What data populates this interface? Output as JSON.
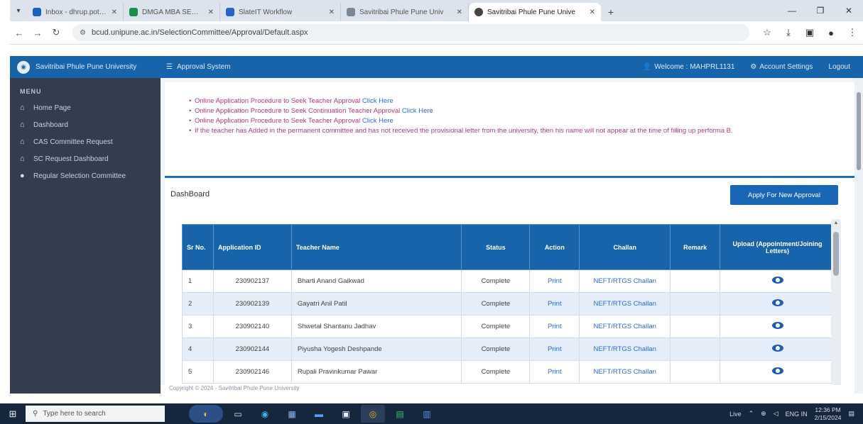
{
  "browser": {
    "tabs": [
      {
        "title": "Inbox - dhrup.pote@aeec",
        "active": false
      },
      {
        "title": "DMGA MBA SEU STATEME",
        "active": false
      },
      {
        "title": "SlateIT Workflow",
        "active": false
      },
      {
        "title": "Savitribai Phule Pune Univ",
        "active": false
      },
      {
        "title": "Savitribai Phule Pune Unive",
        "active": true
      }
    ],
    "url": "bcud.unipune.ac.in/SelectionCommittee/Approval/Default.aspx"
  },
  "header": {
    "university": "Savitribai Phule Pune University",
    "system": "Approval System",
    "welcome": "Welcome : MAHPRL1131",
    "account_settings": "Account Settings",
    "logout": "Logout"
  },
  "sidebar": {
    "menu_heading": "MENU",
    "items": [
      {
        "label": "Home Page"
      },
      {
        "label": "Dashboard"
      },
      {
        "label": "CAS Committee Request"
      },
      {
        "label": "SC Request Dashboard"
      },
      {
        "label": "Regular Selection Committee"
      }
    ]
  },
  "notices": [
    {
      "text": "Online Application Procedure to Seek Teacher Approval",
      "link": "Click Here"
    },
    {
      "text": "Online Application Procedure to Seek Continuation Teacher Approval",
      "link": "Click Here"
    },
    {
      "text": "Online Application Procedure to Seek Teacher Approval",
      "link": "Click Here"
    },
    {
      "text": "If the teacher has Added in the permanent committee and has not received the provisional letter from the university, then his name will not appear at the time of filling up performa B.",
      "link": ""
    }
  ],
  "dashboard": {
    "title": "DashBoard",
    "apply_button": "Apply For New Approval",
    "columns": [
      "Sr No.",
      "Application ID",
      "Teacher Name",
      "Status",
      "Action",
      "Challan",
      "Remark",
      "Upload (Appointment/Joining Letters)"
    ],
    "rows": [
      {
        "sr": "1",
        "app_id": "230902137",
        "name": "Bharti Anand Gaikwad",
        "status": "Complete",
        "action": "Print",
        "challan": "NEFT/RTGS Challan",
        "remark": ""
      },
      {
        "sr": "2",
        "app_id": "230902139",
        "name": "Gayatri Anil Patil",
        "status": "Complete",
        "action": "Print",
        "challan": "NEFT/RTGS Challan",
        "remark": ""
      },
      {
        "sr": "3",
        "app_id": "230902140",
        "name": "Shwetal Shantanu Jadhav",
        "status": "Complete",
        "action": "Print",
        "challan": "NEFT/RTGS Challan",
        "remark": ""
      },
      {
        "sr": "4",
        "app_id": "230902144",
        "name": "Piyusha Yogesh Deshpande",
        "status": "Complete",
        "action": "Print",
        "challan": "NEFT/RTGS Challan",
        "remark": ""
      },
      {
        "sr": "5",
        "app_id": "230902146",
        "name": "Rupali Pravinkumar Pawar",
        "status": "Complete",
        "action": "Print",
        "challan": "NEFT/RTGS Challan",
        "remark": ""
      }
    ]
  },
  "footer": "Copyright © 2024 - Savitribai Phule Pune University",
  "taskbar": {
    "search_placeholder": "Type here to search",
    "weather": "Live",
    "language": "ENG\nIN",
    "time": "12:36 PM",
    "date": "2/15/2024"
  }
}
